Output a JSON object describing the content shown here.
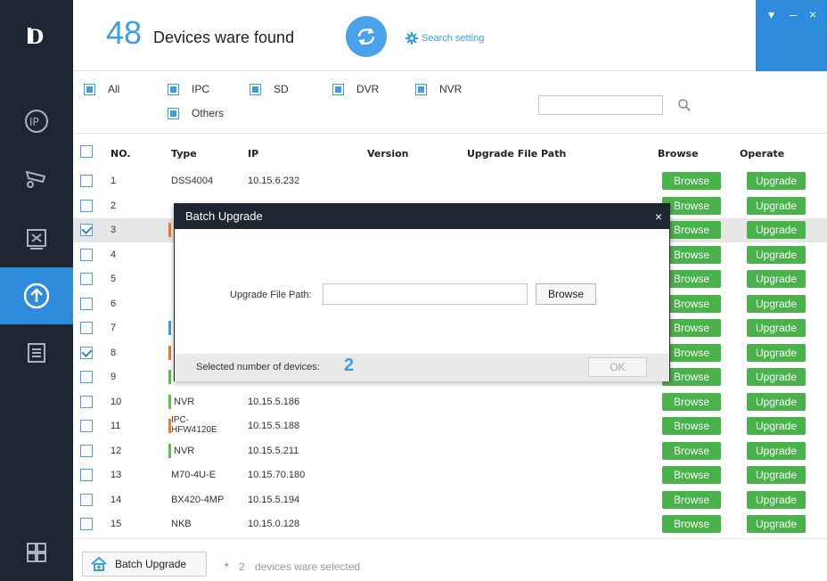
{
  "header": {
    "count": "48",
    "count_label": "Devices ware found",
    "search_setting": "Search setting"
  },
  "filter": {
    "options": [
      "All",
      "IPC",
      "SD",
      "DVR",
      "NVR",
      "Others"
    ],
    "search_placeholder": ""
  },
  "table": {
    "headers": {
      "no": "NO.",
      "type": "Type",
      "ip": "IP",
      "version": "Version",
      "path": "Upgrade File Path",
      "browse": "Browse",
      "operate": "Operate"
    },
    "browse_label": "Browse",
    "upgrade_label": "Upgrade",
    "rows": [
      {
        "no": "1",
        "type": "DSS4004",
        "ip": "10.15.6.232",
        "checked": false,
        "tag": ""
      },
      {
        "no": "2",
        "type": "",
        "ip": "",
        "checked": false,
        "tag": ""
      },
      {
        "no": "3",
        "type": "",
        "ip": "",
        "checked": true,
        "tag": "#f07a2a"
      },
      {
        "no": "4",
        "type": "",
        "ip": "",
        "checked": false,
        "tag": ""
      },
      {
        "no": "5",
        "type": "",
        "ip": "",
        "checked": false,
        "tag": ""
      },
      {
        "no": "6",
        "type": "",
        "ip": "",
        "checked": false,
        "tag": ""
      },
      {
        "no": "7",
        "type": "",
        "ip": "",
        "checked": false,
        "tag": "#3c9de8"
      },
      {
        "no": "8",
        "type": "",
        "ip": "",
        "checked": true,
        "tag": "#f07a2a"
      },
      {
        "no": "9",
        "type": "",
        "ip": "",
        "checked": false,
        "tag": "#58c544"
      },
      {
        "no": "10",
        "type": "NVR",
        "ip": "10.15.5.186",
        "checked": false,
        "tag": "#58c544"
      },
      {
        "no": "11",
        "type": "IPC-\nHFW4120E",
        "ip": "10.15.5.188",
        "checked": false,
        "tag": "#f07a2a"
      },
      {
        "no": "12",
        "type": "NVR",
        "ip": "10.15.5.211",
        "checked": false,
        "tag": "#58c544"
      },
      {
        "no": "13",
        "type": "M70-4U-E",
        "ip": "10.15.70.180",
        "checked": false,
        "tag": ""
      },
      {
        "no": "14",
        "type": "BX420-4MP",
        "ip": "10.15.5.194",
        "checked": false,
        "tag": ""
      },
      {
        "no": "15",
        "type": "NKB",
        "ip": "10.15.0.128",
        "checked": false,
        "tag": ""
      }
    ]
  },
  "footer": {
    "batch_upgrade": "Batch Upgrade",
    "star": "*",
    "selected_count": "2",
    "selected_text": "devices ware selected"
  },
  "dialog": {
    "title": "Batch Upgrade",
    "close": "×",
    "file_path_label": "Upgrade File Path:",
    "file_path_value": "",
    "browse": "Browse",
    "selected_label": "Selected number of devices:",
    "selected_count": "2",
    "ok": "OK"
  },
  "colors": {
    "sidebar": "#1d2631",
    "accent": "#2f8bdc",
    "green": "#49b24a"
  }
}
